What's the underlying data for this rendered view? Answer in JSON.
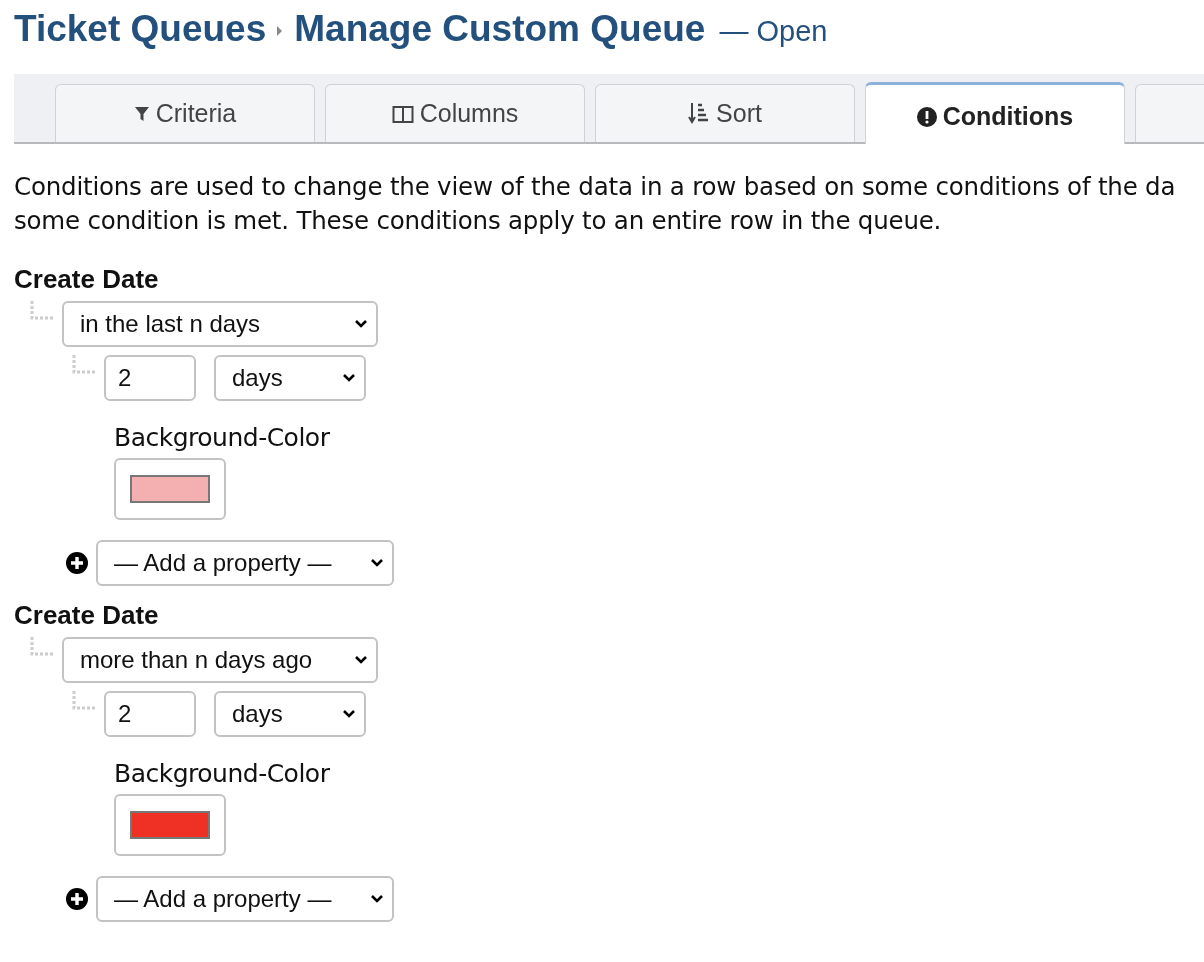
{
  "breadcrumb": {
    "parent": "Ticket Queues",
    "current": "Manage Custom Queue",
    "status": "— Open"
  },
  "tabs": [
    {
      "label": "Criteria",
      "kind": "filter",
      "selected": false
    },
    {
      "label": "Columns",
      "kind": "columns",
      "selected": false
    },
    {
      "label": "Sort",
      "kind": "sort",
      "selected": false
    },
    {
      "label": "Conditions",
      "kind": "alert",
      "selected": true
    }
  ],
  "description": [
    "Conditions are used to change the view of the data in a row based on some conditions of the da",
    "some condition is met. These conditions apply to an entire row in the queue."
  ],
  "conditions": [
    {
      "field": "Create Date",
      "operator": "in the last n days",
      "amount": "2",
      "unit": "days",
      "property_label": "Background-Color",
      "color": "#f4b0b0",
      "add_placeholder": "— Add a property —"
    },
    {
      "field": "Create Date",
      "operator": "more than n days ago",
      "amount": "2",
      "unit": "days",
      "property_label": "Background-Color",
      "color": "#ee3124",
      "add_placeholder": "— Add a property —"
    }
  ]
}
